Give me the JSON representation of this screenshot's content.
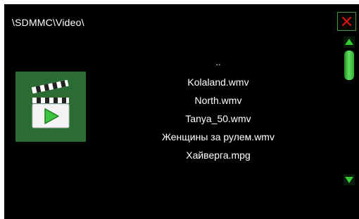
{
  "header": {
    "path": "\\SDMMC\\Video\\"
  },
  "files": [
    "..",
    "Kolaland.wmv",
    "North.wmv",
    "Tanya_50.wmv",
    "Женщины за рулем.wmv",
    "Хайверга.mpg"
  ],
  "icons": {
    "close": "close-icon",
    "category": "video-clapperboard-icon",
    "scroll_up": "triangle-up-icon",
    "scroll_down": "triangle-down-icon"
  },
  "colors": {
    "background": "#000000",
    "tile": "#2b6b34",
    "accent_green": "#33cc33",
    "close_red": "#e01010"
  }
}
